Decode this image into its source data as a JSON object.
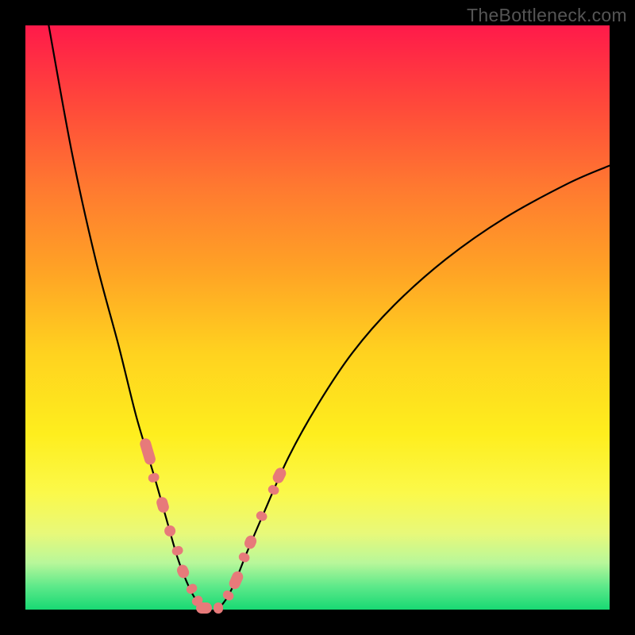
{
  "watermark": "TheBottleneck.com",
  "chart_data": {
    "type": "line",
    "title": "",
    "xlabel": "",
    "ylabel": "",
    "xlim": [
      0,
      100
    ],
    "ylim": [
      0,
      100
    ],
    "left_curve": {
      "x": [
        4,
        8,
        12,
        16,
        19,
        22,
        24,
        26,
        27.5,
        29,
        30.5,
        31
      ],
      "y": [
        100,
        78,
        60,
        45,
        33,
        23,
        16,
        9,
        5,
        2,
        0.5,
        0
      ]
    },
    "right_curve": {
      "x": [
        33,
        34.5,
        36,
        38,
        41,
        45,
        50,
        56,
        63,
        72,
        82,
        93,
        100
      ],
      "y": [
        0,
        2,
        5,
        10,
        17,
        26,
        35,
        44,
        52,
        60,
        67,
        73,
        76
      ]
    },
    "markers_left": [
      {
        "x": 21.0,
        "y": 27.0,
        "len": 6.0
      },
      {
        "x": 22.0,
        "y": 22.5,
        "len": 2.0
      },
      {
        "x": 23.5,
        "y": 18.0,
        "len": 3.5
      },
      {
        "x": 24.8,
        "y": 13.5,
        "len": 2.5
      },
      {
        "x": 26.0,
        "y": 10.0,
        "len": 2.0
      },
      {
        "x": 27.0,
        "y": 6.5,
        "len": 3.0
      },
      {
        "x": 28.5,
        "y": 3.5,
        "len": 2.0
      },
      {
        "x": 29.5,
        "y": 1.5,
        "len": 2.0
      }
    ],
    "markers_bottom": [
      {
        "x": 30.5,
        "y": 0.3,
        "len": 3.5
      },
      {
        "x": 33.0,
        "y": 0.3,
        "len": 2.0
      }
    ],
    "markers_right": [
      {
        "x": 34.8,
        "y": 2.5,
        "len": 2.0
      },
      {
        "x": 36.0,
        "y": 5.0,
        "len": 4.0
      },
      {
        "x": 37.5,
        "y": 9.0,
        "len": 2.0
      },
      {
        "x": 38.5,
        "y": 11.5,
        "len": 3.0
      },
      {
        "x": 40.5,
        "y": 16.0,
        "len": 2.0
      },
      {
        "x": 42.5,
        "y": 20.5,
        "len": 2.0
      },
      {
        "x": 43.5,
        "y": 23.0,
        "len": 3.5
      }
    ]
  }
}
